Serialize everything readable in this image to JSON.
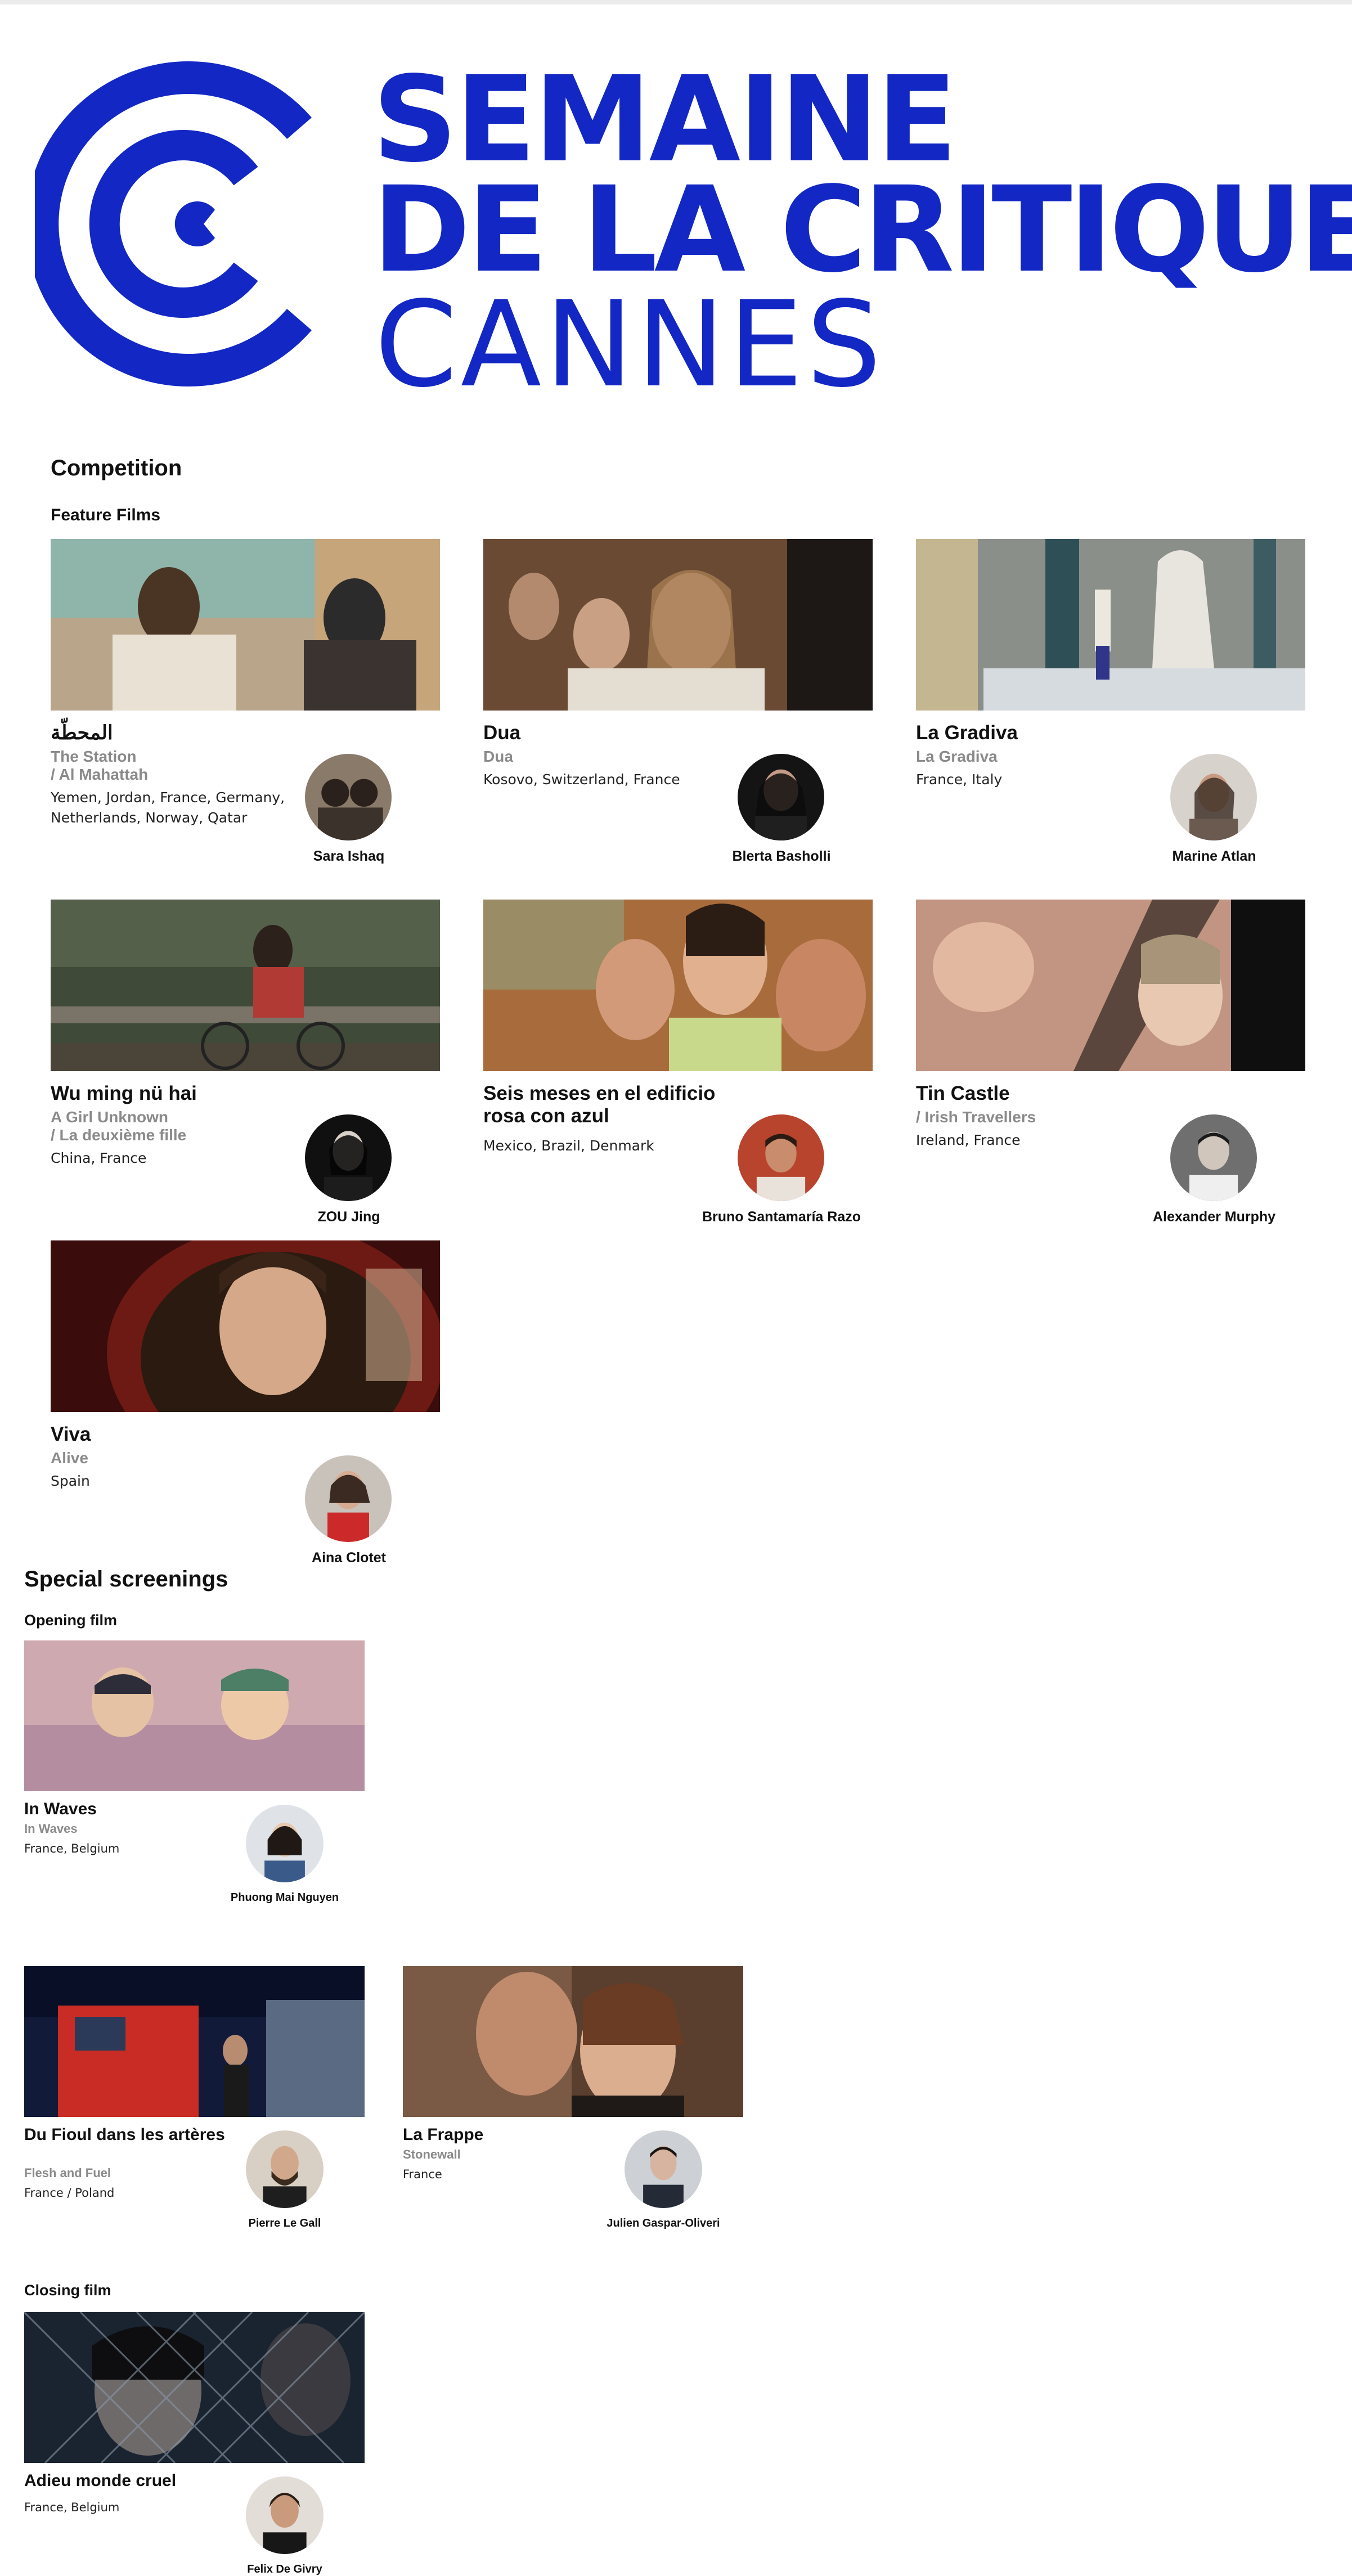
{
  "header": {
    "logo_line1": "SEMAINE",
    "logo_line2": "DE LA CRITIQUE",
    "logo_line3": "CANNES",
    "brand_color": "#1327c4"
  },
  "competition": {
    "title": "Competition",
    "subtitle": "Feature Films",
    "films": [
      {
        "title": "المحطّة",
        "alt1": "The Station",
        "alt2": "/ Al Mahattah",
        "country": "Yemen, Jordan, France, Germany, Netherlands, Norway, Qatar",
        "director": "Sara Ishaq"
      },
      {
        "title": "Dua",
        "alt1": "Dua",
        "alt2": "",
        "country": "Kosovo, Switzerland, France",
        "director": "Blerta Basholli"
      },
      {
        "title": "La Gradiva",
        "alt1": "La Gradiva",
        "alt2": "",
        "country": "France, Italy",
        "director": "Marine Atlan"
      },
      {
        "title": "Wu ming nü hai",
        "alt1": "A Girl Unknown",
        "alt2": "/ La deuxième fille",
        "country": "China, France",
        "director": "ZOU Jing"
      },
      {
        "title": "Seis meses en el edificio rosa con azul",
        "alt1": "",
        "alt2": "",
        "country": "Mexico, Brazil, Denmark",
        "director": "Bruno Santamaría Razo"
      },
      {
        "title": "Tin Castle",
        "alt1": "/ Irish Travellers",
        "alt2": "",
        "country": "Ireland, France",
        "director": "Alexander Murphy"
      },
      {
        "title": "Viva",
        "alt1": "Alive",
        "alt2": "",
        "country": "Spain",
        "director": "Aina Clotet"
      }
    ]
  },
  "special": {
    "title": "Special screenings",
    "opening_label": "Opening film",
    "closing_label": "Closing film",
    "opening": {
      "title": "In Waves",
      "alt1": "In Waves",
      "country": "France, Belgium",
      "director": "Phuong Mai Nguyen"
    },
    "films": [
      {
        "title": "Du Fioul dans les artères",
        "alt1": "Flesh and Fuel",
        "country": "France / Poland",
        "director": "Pierre Le Gall"
      },
      {
        "title": "La Frappe",
        "alt1": "Stonewall",
        "country": "France",
        "director": "Julien Gaspar-Oliveri"
      }
    ],
    "closing": {
      "title": "Adieu monde cruel",
      "country": "France, Belgium",
      "director": "Felix De Givry"
    }
  }
}
